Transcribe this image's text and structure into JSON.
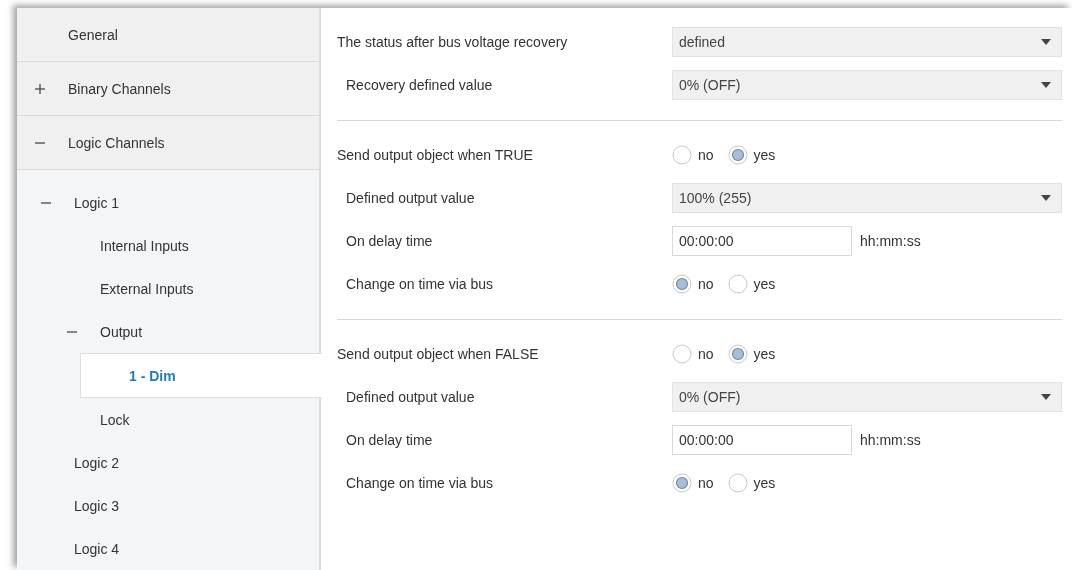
{
  "sidebar": {
    "items": [
      {
        "label": "General"
      },
      {
        "label": "Binary Channels",
        "expanded": false
      },
      {
        "label": "Logic Channels",
        "expanded": true,
        "children": [
          {
            "label": "Logic 1",
            "expanded": true,
            "children": [
              {
                "label": "Internal Inputs",
                "selected": false
              },
              {
                "label": "External Inputs",
                "selected": false
              },
              {
                "label": "Output",
                "expanded": true,
                "children": [
                  {
                    "label": "1 - Dim",
                    "selected": true
                  }
                ]
              },
              {
                "label": "Lock",
                "selected": false
              }
            ]
          },
          {
            "label": "Logic 2",
            "selected": false
          },
          {
            "label": "Logic 3",
            "selected": false
          },
          {
            "label": "Logic 4",
            "selected": false
          }
        ]
      }
    ]
  },
  "sections": [
    {
      "params": [
        {
          "kind": "dropdown",
          "label": "The status after bus voltage recovery",
          "value": "defined",
          "children": [
            {
              "kind": "dropdown",
              "label": "Recovery defined value",
              "value": "0% (OFF)"
            }
          ]
        }
      ]
    },
    {
      "params": [
        {
          "kind": "radio",
          "label": "Send output object when TRUE",
          "options": [
            {
              "label": "no",
              "selected": false
            },
            {
              "label": "yes",
              "selected": true
            }
          ],
          "children": [
            {
              "kind": "dropdown",
              "label": "Defined output value",
              "value": "100% (255)"
            },
            {
              "kind": "time",
              "label": "On delay time",
              "value": "00:00:00",
              "unit": "hh:mm:ss"
            },
            {
              "kind": "radio",
              "label": "Change on time via bus",
              "options": [
                {
                  "label": "no",
                  "selected": true
                },
                {
                  "label": "yes",
                  "selected": false
                }
              ]
            }
          ]
        }
      ]
    },
    {
      "params": [
        {
          "kind": "radio",
          "label": "Send output object when FALSE",
          "options": [
            {
              "label": "no",
              "selected": false
            },
            {
              "label": "yes",
              "selected": true
            }
          ],
          "children": [
            {
              "kind": "dropdown",
              "label": "Defined output value",
              "value": "0% (OFF)"
            },
            {
              "kind": "time",
              "label": "On delay time",
              "value": "00:00:00",
              "unit": "hh:mm:ss"
            },
            {
              "kind": "radio",
              "label": "Change on time via bus",
              "options": [
                {
                  "label": "no",
                  "selected": true
                },
                {
                  "label": "yes",
                  "selected": false
                }
              ]
            }
          ]
        }
      ]
    }
  ]
}
